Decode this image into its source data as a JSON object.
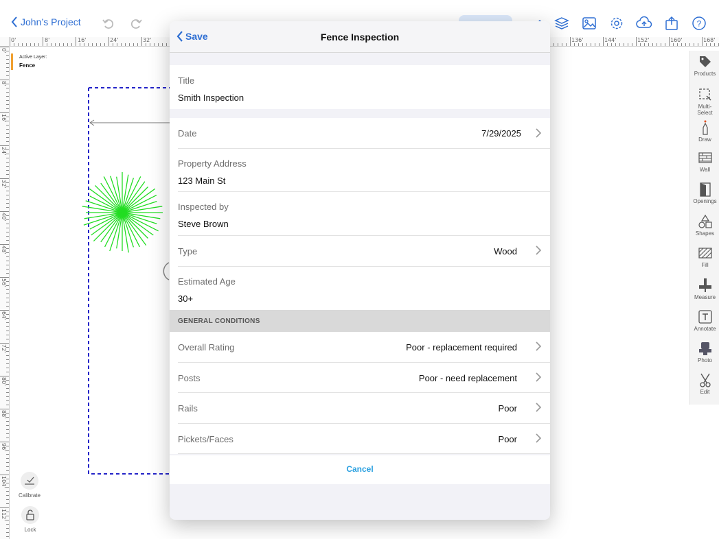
{
  "topbar": {
    "back_label": "John’s Project",
    "bg_title": "Fence Inspection"
  },
  "ruler": {
    "top_labels": [
      "0'",
      "8'",
      "16'",
      "24'",
      "32'",
      "136'",
      "144'",
      "152'",
      "160'",
      "168'"
    ],
    "left_labels": [
      "0'",
      "8'",
      "16'",
      "24'",
      "32'",
      "40'",
      "48'",
      "56'",
      "64'",
      "72'",
      "80'",
      "88'",
      "96'",
      "104'",
      "112'"
    ]
  },
  "canvas": {
    "active_layer_label": "Active Layer:",
    "active_layer_value": "Fence",
    "calibrate_label": "Calibrate",
    "lock_label": "Lock",
    "fence_color": "#2323c8",
    "marker_color": "#22dd22"
  },
  "right_toolbar": {
    "items": [
      {
        "label": "Products",
        "icon": "tag-icon"
      },
      {
        "label": "Multi-\nSelect",
        "icon": "multi-select-icon"
      },
      {
        "label": "Draw",
        "icon": "draw-pen-icon"
      },
      {
        "label": "Wall",
        "icon": "wall-icon"
      },
      {
        "label": "Openings",
        "icon": "door-icon"
      },
      {
        "label": "Shapes",
        "icon": "shapes-icon"
      },
      {
        "label": "Fill",
        "icon": "fill-icon"
      },
      {
        "label": "Measure",
        "icon": "measure-icon"
      },
      {
        "label": "Annotate",
        "icon": "text-box-icon"
      },
      {
        "label": "Photo",
        "icon": "camera-icon"
      },
      {
        "label": "Edit",
        "icon": "scissors-icon"
      }
    ]
  },
  "modal": {
    "save_label": "Save",
    "title": "Fence Inspection",
    "fields": {
      "title_label": "Title",
      "title_value": "Smith Inspection",
      "date_label": "Date",
      "date_value": "7/29/2025",
      "address_label": "Property Address",
      "address_value": "123 Main St",
      "inspected_by_label": "Inspected by",
      "inspected_by_value": "Steve Brown",
      "type_label": "Type",
      "type_value": "Wood",
      "age_label": "Estimated Age",
      "age_value": "30+"
    },
    "section_header": "GENERAL CONDITIONS",
    "conditions": [
      {
        "label": "Overall Rating",
        "value": "Poor - replacement required"
      },
      {
        "label": "Posts",
        "value": "Poor - need replacement"
      },
      {
        "label": "Rails",
        "value": "Poor"
      },
      {
        "label": "Pickets/Faces",
        "value": "Poor"
      }
    ],
    "cancel_label": "Cancel"
  },
  "colors": {
    "accent": "#2f6fd3",
    "cancel": "#2aa0e0",
    "layer_marker": "#f0a030"
  }
}
